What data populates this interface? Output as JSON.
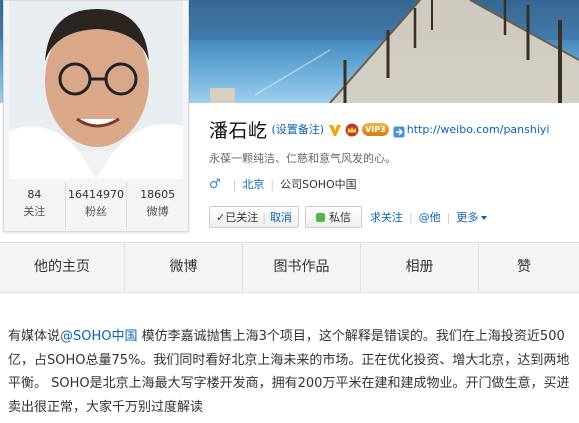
{
  "profile": {
    "name": "潘石屹",
    "remark": "(设置备注)",
    "vip_label": "VIP3",
    "url": "http://weibo.com/panshiyi",
    "bio": "永葆一颗纯洁、仁慈和意气风发的心。",
    "gender_icon": "male-symbol",
    "gender_glyph": "♂",
    "location": "北京",
    "company": "公司SOHO中国"
  },
  "stats": [
    {
      "num": "84",
      "label": "关注"
    },
    {
      "num": "16414970",
      "label": "粉丝"
    },
    {
      "num": "18605",
      "label": "微博"
    }
  ],
  "actions": {
    "followed": "✓已关注",
    "divider": "|",
    "cancel": "取消",
    "message": "私信",
    "ask_follow": "求关注",
    "at_him": "@他",
    "more": "更多",
    "separator": "|"
  },
  "tabs": [
    {
      "label": "他的主页"
    },
    {
      "label": "微博"
    },
    {
      "label": "图书作品"
    },
    {
      "label": "相册"
    },
    {
      "label": "赞"
    }
  ],
  "post": {
    "prefix": "有媒体说",
    "mention": "@SOHO中国",
    "body": " 模仿李嘉诚抛售上海3个项目，这个解释是错误的。我们在上海投资近500亿，占SOHO总量75%。我们同时看好北京上海未来的市场。正在优化投资、增大北京，达到两地平衡。 SOHO是北京上海最大写字楼开发商，拥有200万平米在建和建成物业。开门做生意，买进卖出很正常，大家千万别过度解读"
  },
  "colors": {
    "link": "#0a64b4",
    "tab_bg": "#f4f4f4",
    "message_dot": "#52b848"
  }
}
